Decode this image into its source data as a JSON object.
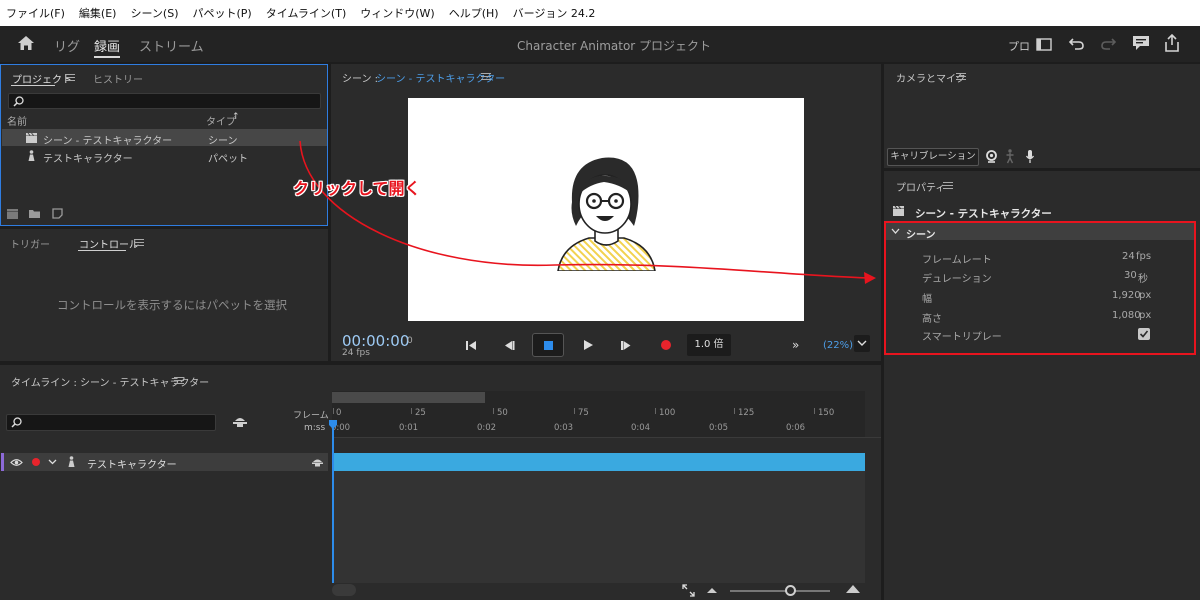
{
  "menubar": [
    "ファイル(F)",
    "編集(E)",
    "シーン(S)",
    "パペット(P)",
    "タイムライン(T)",
    "ウィンドウ(W)",
    "ヘルプ(H)",
    "バージョン 24.2"
  ],
  "appbar": {
    "modes": [
      "リグ",
      "録画",
      "ストリーム"
    ],
    "active_mode": "録画",
    "project_title": "Character Animator プロジェクト",
    "pro_label": "プロ"
  },
  "project_panel": {
    "tabs": [
      "プロジェクト",
      "ヒストリー"
    ],
    "columns": {
      "name": "名前",
      "type": "タイプ"
    },
    "rows": [
      {
        "name": "シーン - テストキャラクター",
        "type": "シーン",
        "icon": "clapper-icon"
      },
      {
        "name": "テストキャラクター",
        "type": "パペット",
        "icon": "puppet-icon"
      }
    ]
  },
  "controls_panel": {
    "tabs": [
      "トリガー",
      "コントロール"
    ],
    "empty_message": "コントロールを表示するにはパペットを選択"
  },
  "scene_panel": {
    "title_prefix": "シーン : ",
    "title_scene": "シーン - テストキャラクター",
    "timecode": "00:00:00",
    "frame": "0",
    "fps": "24 fps",
    "speed": "1.0 倍",
    "zoom": "(22%)"
  },
  "annotation": {
    "text": "クリックして開く",
    "color": "#e8141e"
  },
  "camera_panel": {
    "title": "カメラとマイク",
    "calibration": "キャリブレーション"
  },
  "properties_panel": {
    "title": "プロパティ",
    "object_name": "シーン - テストキャラクター",
    "section": "シーン",
    "rows": [
      {
        "label": "フレームレート",
        "value": "24",
        "unit": "fps"
      },
      {
        "label": "デュレーション",
        "value": "30",
        "unit": "秒"
      },
      {
        "label": "幅",
        "value": "1,920",
        "unit": "px"
      },
      {
        "label": "高さ",
        "value": "1,080",
        "unit": "px"
      },
      {
        "label": "スマートリプレー",
        "value": "",
        "unit": ""
      }
    ]
  },
  "timeline": {
    "title": "タイムライン : シーン - テストキャラクター",
    "frame_label": "フレーム",
    "time_label": "m:ss",
    "frame_ticks": [
      "0",
      "25",
      "50",
      "75",
      "100",
      "125",
      "150"
    ],
    "time_ticks": [
      "0:00",
      "0:01",
      "0:02",
      "0:03",
      "0:04",
      "0:05",
      "0:06"
    ],
    "track_name": "テストキャラクター"
  },
  "colors": {
    "accent_blue": "#4d9ee8",
    "track_blue": "#3aa9e0",
    "annotation_red": "#e8141e"
  }
}
